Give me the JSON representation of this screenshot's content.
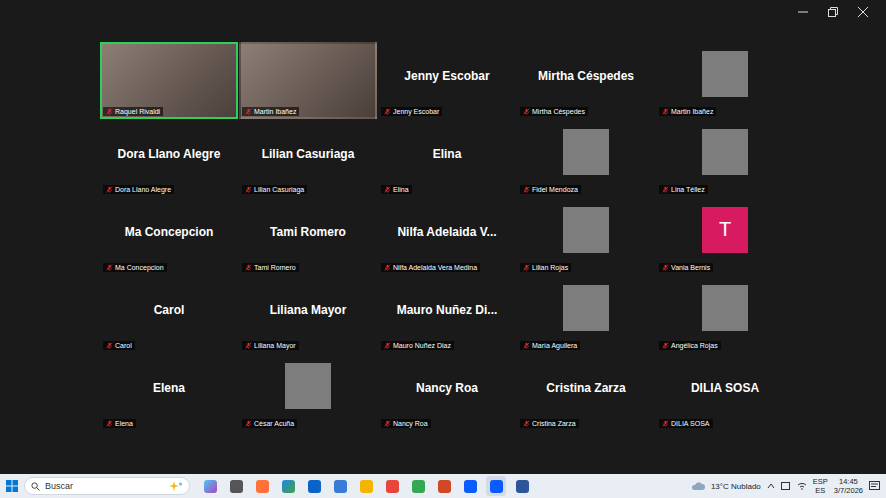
{
  "window": {
    "app": "Zoom"
  },
  "tiles": [
    {
      "kind": "video",
      "display": "",
      "label": "Raquel Rivaldi",
      "muted": true,
      "speaking": true
    },
    {
      "kind": "video",
      "display": "",
      "label": "Martin Ibañez",
      "muted": true,
      "speaking": false
    },
    {
      "kind": "name",
      "display": "Jenny Escobar",
      "label": "Jenny Escobar",
      "muted": true,
      "speaking": false
    },
    {
      "kind": "name",
      "display": "Mirtha Céspedes",
      "label": "Mirtha Céspedes",
      "muted": true,
      "speaking": false
    },
    {
      "kind": "photo",
      "display": "",
      "label": "Martin Ibañez",
      "muted": true,
      "speaking": false
    },
    {
      "kind": "name",
      "display": "Dora Llano Alegre",
      "label": "Dora Llano Alegre",
      "muted": true,
      "speaking": false
    },
    {
      "kind": "name",
      "display": "Lilian Casuriaga",
      "label": "Lilian Casuriaga",
      "muted": true,
      "speaking": false
    },
    {
      "kind": "name",
      "display": "Elina",
      "label": "Elina",
      "muted": true,
      "speaking": false
    },
    {
      "kind": "photo",
      "display": "",
      "label": "Fidel Mendoza",
      "muted": true,
      "speaking": false
    },
    {
      "kind": "photo",
      "display": "",
      "label": "Lina Téllez",
      "muted": true,
      "speaking": false
    },
    {
      "kind": "name",
      "display": "Ma Concepcion",
      "label": "Ma Concepcion",
      "muted": true,
      "speaking": false
    },
    {
      "kind": "name",
      "display": "Tami Romero",
      "label": "Tami Romero",
      "muted": true,
      "speaking": false
    },
    {
      "kind": "name",
      "display": "Nilfa Adelaida V...",
      "label": "Nilfa Adelaida Vera Medina",
      "muted": true,
      "speaking": false
    },
    {
      "kind": "photo",
      "display": "",
      "label": "Lilian Rojas",
      "muted": true,
      "speaking": false
    },
    {
      "kind": "avatar",
      "display": "T",
      "label": "Vania Bernis",
      "muted": true,
      "speaking": false,
      "color": "#d81b60"
    },
    {
      "kind": "name",
      "display": "Carol",
      "label": "Carol",
      "muted": true,
      "speaking": false
    },
    {
      "kind": "name",
      "display": "Liliana Mayor",
      "label": "Liliana Mayor",
      "muted": true,
      "speaking": false
    },
    {
      "kind": "name",
      "display": "Mauro Nuñez Di...",
      "label": "Mauro Nuñez Diaz",
      "muted": true,
      "speaking": false
    },
    {
      "kind": "photo",
      "display": "",
      "label": "María Aguilera",
      "muted": true,
      "speaking": false
    },
    {
      "kind": "photo",
      "display": "",
      "label": "Angélica Rojas",
      "muted": true,
      "speaking": false
    },
    {
      "kind": "name",
      "display": "Elena",
      "label": "Elena",
      "muted": true,
      "speaking": false
    },
    {
      "kind": "photo",
      "display": "",
      "label": "César Acuña",
      "muted": true,
      "speaking": false
    },
    {
      "kind": "name",
      "display": "Nancy Roa",
      "label": "Nancy Roa",
      "muted": true,
      "speaking": false
    },
    {
      "kind": "name",
      "display": "Cristina Zarza",
      "label": "Cristina Zarza",
      "muted": true,
      "speaking": false
    },
    {
      "kind": "name",
      "display": "DILIA SOSA",
      "label": "DILIA SOSA",
      "muted": true,
      "speaking": false
    }
  ],
  "taskbar": {
    "search": {
      "placeholder": "Buscar"
    },
    "apps": [
      {
        "active": false
      },
      {
        "active": false
      },
      {
        "active": false
      },
      {
        "active": false
      },
      {
        "active": false
      },
      {
        "active": false
      },
      {
        "active": false
      },
      {
        "active": false
      },
      {
        "active": false
      },
      {
        "active": false
      },
      {
        "active": false
      },
      {
        "active": true
      },
      {
        "active": false
      }
    ],
    "weather": "13°C Nublado",
    "language": "ESP",
    "layout": "ES",
    "time": "14:45",
    "date": "3/7/2026"
  }
}
